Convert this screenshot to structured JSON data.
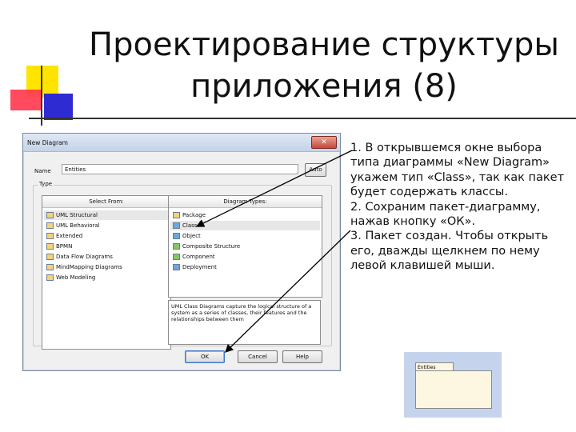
{
  "slide": {
    "title_line1": "Проектирование структуры",
    "title_line2": "приложения (8)"
  },
  "dialog": {
    "window_title": "New Diagram",
    "close_symbol": "✕",
    "name_label": "Name",
    "name_value": "Entities",
    "auto_label": "Auto",
    "type_label": "Type",
    "select_from_header": "Select From:",
    "diagram_types_header": "Diagram Types:",
    "select_from": [
      "UML Structural",
      "UML Behavioral",
      "Extended",
      "BPMN",
      "Data Flow Diagrams",
      "MindMapping Diagrams",
      "Web Modeling"
    ],
    "diagram_types": [
      "Package",
      "Class",
      "Object",
      "Composite Structure",
      "Component",
      "Deployment"
    ],
    "description": "UML Class Diagrams capture the logical structure of a system as a series of classes, their features and the relationships between them",
    "ok_label": "OK",
    "cancel_label": "Cancel",
    "help_label": "Help"
  },
  "instructions": {
    "step1": "1. В открывшемся окне выбора типа диаграммы «New Diagram» укажем тип «Class», так как пакет будет содержать классы.",
    "step2": "2. Сохраним пакет-диаграмму, нажав кнопку «ОК».",
    "step3": "3. Пакет создан. Чтобы открыть его, дважды щелкнем по нему левой клавишей мыши."
  },
  "result": {
    "package_name": "Entities"
  },
  "colors": {
    "deco_yellow": "#ffe400",
    "deco_red": "#ff3b52",
    "deco_blue": "#2e2bd3",
    "result_bg": "#c5d4ec",
    "package_fill": "#fdf6e0"
  }
}
